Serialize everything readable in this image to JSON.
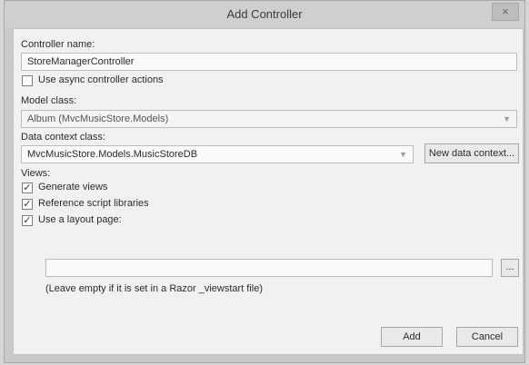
{
  "window": {
    "title": "Add Controller",
    "close_glyph": "×"
  },
  "controller_name": {
    "label": "Controller name:",
    "value": "StoreManagerController"
  },
  "async_actions": {
    "label": "Use async controller actions",
    "checked": false
  },
  "model_class": {
    "label": "Model class:",
    "value": "Album (MvcMusicStore.Models)"
  },
  "data_context": {
    "label": "Data context class:",
    "value": "MvcMusicStore.Models.MusicStoreDB",
    "new_button_label": "New data context..."
  },
  "views": {
    "label": "Views:",
    "generate_views": {
      "label": "Generate views",
      "checked": true
    },
    "reference_scripts": {
      "label": "Reference script libraries",
      "checked": true
    },
    "use_layout": {
      "label": "Use a layout page:",
      "checked": true
    },
    "layout_path": "",
    "browse_label": "...",
    "hint": "(Leave empty if it is set in a Razor _viewstart file)"
  },
  "buttons": {
    "add": "Add",
    "cancel": "Cancel"
  },
  "icons": {
    "checked": "check-mark-icon",
    "dropdown": "chevron-down-icon"
  }
}
